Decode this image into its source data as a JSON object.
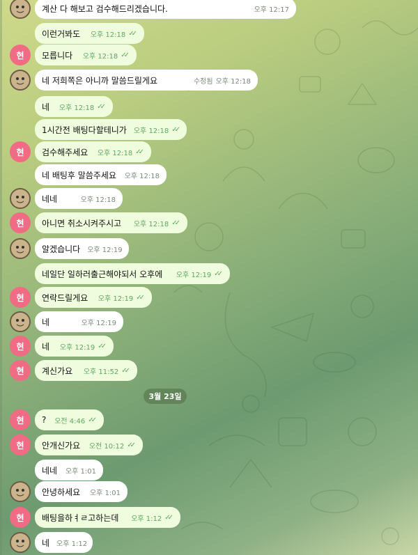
{
  "date_divider": "3월 23일",
  "avatar_initial": "현",
  "messages": [
    {
      "side": "in",
      "text": "계산 다 해보고 검수해드리겠습니다.",
      "time": "오후 12:17",
      "edited": "",
      "avatar": true
    },
    {
      "side": "out",
      "text": "이런거봐도",
      "time": "오후 12:18",
      "edited": "",
      "avatar": false
    },
    {
      "side": "out",
      "text": "모릅니다",
      "time": "오후 12:18",
      "edited": "",
      "avatar": true
    },
    {
      "side": "in",
      "text": "네 저희쪽은 아니까 말씀드릴게요",
      "time": "오후 12:18",
      "edited": "수정됨",
      "avatar": true
    },
    {
      "side": "out",
      "text": "네",
      "time": "오후 12:18",
      "edited": "",
      "avatar": false
    },
    {
      "side": "out",
      "text": "1시간전 배팅다할테니가",
      "time": "오후 12:18",
      "edited": "",
      "avatar": false
    },
    {
      "side": "out",
      "text": "검수해주세요",
      "time": "오후 12:18",
      "edited": "",
      "avatar": true
    },
    {
      "side": "in",
      "text": "네 배팅후 말씀주세요",
      "time": "오후 12:18",
      "edited": "",
      "avatar": false
    },
    {
      "side": "in",
      "text": "네네",
      "time": "오후 12:18",
      "edited": "",
      "avatar": true
    },
    {
      "side": "out",
      "text": "아니면 취소시켜주시고",
      "time": "오후 12:18",
      "edited": "",
      "avatar": true
    },
    {
      "side": "in",
      "text": "알겠습니다",
      "time": "오후 12:19",
      "edited": "",
      "avatar": true
    },
    {
      "side": "out",
      "text": "네일단 일하러출근해야되서 오후에",
      "time": "오후 12:19",
      "edited": "",
      "avatar": false
    },
    {
      "side": "out",
      "text": "연락드릴게요",
      "time": "오후 12:19",
      "edited": "",
      "avatar": true
    },
    {
      "side": "in",
      "text": "네",
      "time": "오후 12:19",
      "edited": "",
      "avatar": true
    },
    {
      "side": "out",
      "text": "네",
      "time": "오후 12:19",
      "edited": "",
      "avatar": true
    },
    {
      "side": "out",
      "text": "계신가요",
      "time": "오후 11:52",
      "edited": "",
      "avatar": true
    },
    {
      "side": "out",
      "text": "?",
      "time": "오전 4:46",
      "edited": "",
      "avatar": true
    },
    {
      "side": "out",
      "text": "안개신가요",
      "time": "오전 10:12",
      "edited": "",
      "avatar": true
    },
    {
      "side": "in",
      "text": "네네",
      "time": "오후 1:01",
      "edited": "",
      "avatar": false
    },
    {
      "side": "in",
      "text": "안녕하세요",
      "time": "오후 1:01",
      "edited": "",
      "avatar": true
    },
    {
      "side": "out",
      "text": "배팅을하ㅕㄹ고하는데",
      "time": "오후 1:12",
      "edited": "",
      "avatar": true
    },
    {
      "side": "in",
      "text": "네",
      "time": "오후 1:12",
      "edited": "",
      "avatar": true
    }
  ]
}
